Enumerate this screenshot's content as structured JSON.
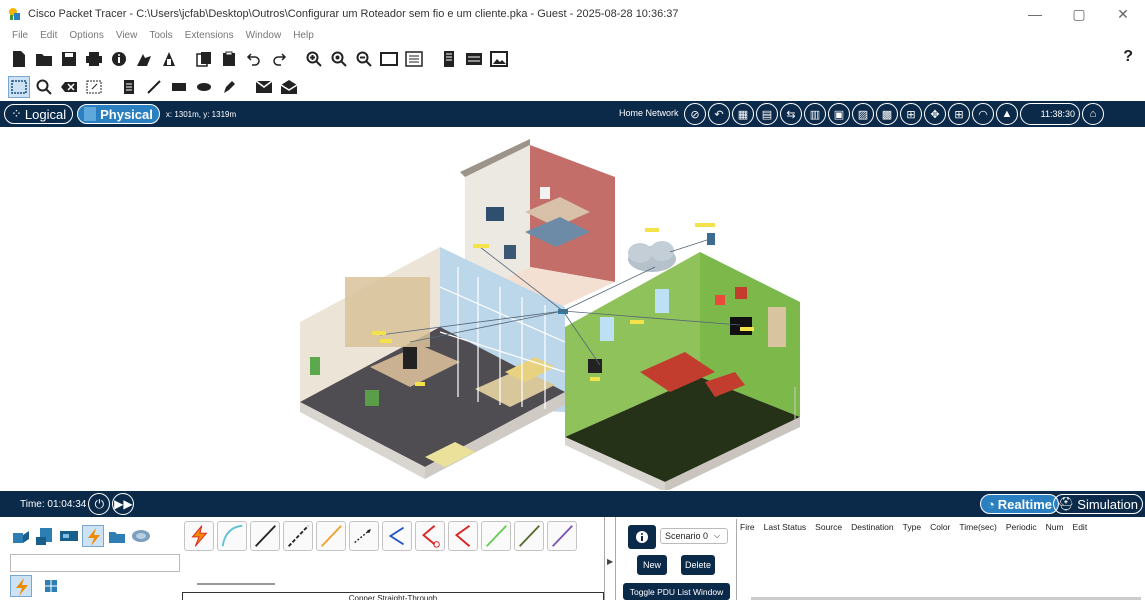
{
  "window": {
    "title": "Cisco Packet Tracer - C:\\Users\\jcfab\\Desktop\\Outros\\Configurar um Roteador sem fio e um cliente.pka - Guest - 2025-08-28 10:36:37",
    "minimize": "—",
    "maximize": "▢",
    "close": "✕"
  },
  "menu": [
    "File",
    "Edit",
    "Options",
    "View",
    "Tools",
    "Extensions",
    "Window",
    "Help"
  ],
  "toolbar": {
    "icons": [
      "new-file-icon",
      "open-folder-icon",
      "save-icon",
      "print-icon",
      "activity-wizard-icon",
      "network-info-icon",
      "custom-device-icon",
      "copy-icon",
      "paste-icon",
      "undo-icon",
      "redo-icon",
      "zoom-in-icon",
      "zoom-reset-icon",
      "zoom-out-icon",
      "drawing-palette-icon",
      "device-template-icon",
      "cluster-icon",
      "viewport-icon",
      "screenshot-icon"
    ],
    "help": "?"
  },
  "tools": [
    "select-icon",
    "inspect-icon",
    "delete-icon",
    "resize-icon",
    "note-icon",
    "line-icon",
    "rectangle-icon",
    "ellipse-icon",
    "freeform-icon",
    "add-simple-pdu-icon",
    "add-complex-pdu-icon"
  ],
  "nav": {
    "logical": "Logical",
    "physical": "Physical",
    "coords": "x: 1301m, y: 1319m",
    "location": "Home Network",
    "clock": "11:38:30",
    "icons": [
      "navigation-icon",
      "back-icon",
      "new-city-icon",
      "new-building-icon",
      "move-object-icon",
      "new-closet-icon",
      "new-rack-icon",
      "new-table-icon",
      "grid-icon",
      "tile-icon",
      "set-background-icon",
      "viewport-icon",
      "wireless-icon",
      "environment-icon",
      "power-icon",
      "home-icon"
    ]
  },
  "timebar": {
    "time": "Time: 01:04:34",
    "realtime": "Realtime",
    "simulation": "Simulation"
  },
  "bottom": {
    "device_categories": [
      "network-devices-icon",
      "end-devices-icon",
      "components-icon",
      "connections-icon",
      "misc-icon",
      "multiuser-icon"
    ],
    "cable_types": [
      "automatic-cable-icon",
      "console-cable-icon",
      "copper-straight-icon",
      "copper-cross-icon",
      "fiber-icon",
      "phone-cable-icon",
      "coaxial-cable-icon",
      "serial-dce-icon",
      "serial-dte-icon",
      "octal-cable-icon",
      "iot-cable-icon",
      "usb-cable-icon"
    ],
    "cable_label": "Copper Straight-Through",
    "scenario": "Scenario 0",
    "new": "New",
    "delete": "Delete",
    "toggle": "Toggle PDU List Window",
    "pdu_columns": [
      "Fire",
      "Last Status",
      "Source",
      "Destination",
      "Type",
      "Color",
      "Time(sec)",
      "Periodic",
      "Num",
      "Edit"
    ]
  },
  "colors": {
    "navbar": "#0b2a4a",
    "accent": "#2a7fc1"
  }
}
